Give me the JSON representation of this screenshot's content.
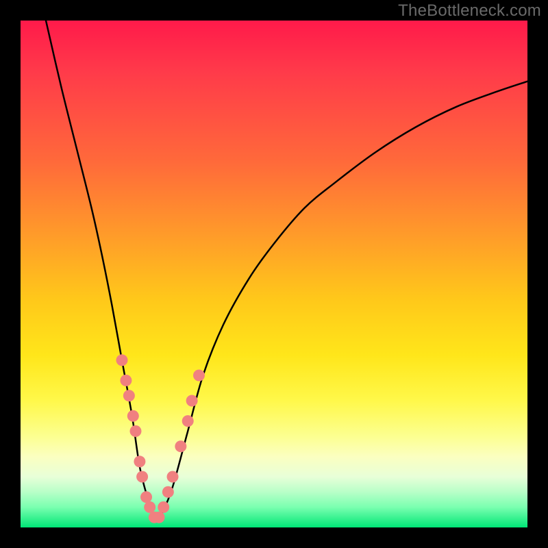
{
  "watermark": "TheBottleneck.com",
  "chart_data": {
    "type": "line",
    "title": "",
    "xlabel": "",
    "ylabel": "",
    "ylim": [
      0,
      100
    ],
    "xlim": [
      0,
      100
    ],
    "series": [
      {
        "name": "curve",
        "x": [
          5,
          8,
          11,
          14,
          16,
          18,
          20,
          22,
          23.5,
          25,
          26,
          27,
          28,
          30,
          33,
          36,
          40,
          45,
          50,
          56,
          62,
          70,
          78,
          86,
          94,
          100
        ],
        "y": [
          100,
          87,
          75,
          63,
          54,
          44,
          33,
          22,
          12,
          6,
          3,
          2,
          3,
          8,
          19,
          30,
          40,
          49,
          56,
          63,
          68,
          74,
          79,
          83,
          86,
          88
        ]
      }
    ],
    "markers": {
      "name": "data-points",
      "color": "#f08080",
      "points": [
        {
          "x": 20,
          "y": 33
        },
        {
          "x": 20.8,
          "y": 29
        },
        {
          "x": 21.4,
          "y": 26
        },
        {
          "x": 22.2,
          "y": 22
        },
        {
          "x": 22.7,
          "y": 19
        },
        {
          "x": 23.5,
          "y": 13
        },
        {
          "x": 24.0,
          "y": 10
        },
        {
          "x": 24.8,
          "y": 6
        },
        {
          "x": 25.5,
          "y": 4
        },
        {
          "x": 26.4,
          "y": 2
        },
        {
          "x": 27.3,
          "y": 2
        },
        {
          "x": 28.2,
          "y": 4
        },
        {
          "x": 29.1,
          "y": 7
        },
        {
          "x": 30.0,
          "y": 10
        },
        {
          "x": 31.6,
          "y": 16
        },
        {
          "x": 33.0,
          "y": 21
        },
        {
          "x": 33.8,
          "y": 25
        },
        {
          "x": 35.2,
          "y": 30
        }
      ]
    },
    "gradient_bands": [
      {
        "color": "#ff1a4a",
        "y": 100
      },
      {
        "color": "#ff9a2a",
        "y": 58
      },
      {
        "color": "#ffe61a",
        "y": 34
      },
      {
        "color": "#fcff90",
        "y": 18
      },
      {
        "color": "#00e676",
        "y": 0
      }
    ]
  }
}
